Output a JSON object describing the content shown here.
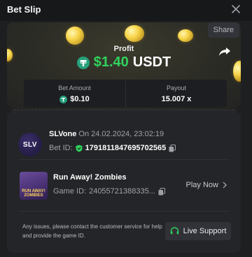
{
  "modal": {
    "title": "Bet Slip"
  },
  "hero": {
    "share_label": "Share",
    "profit_label": "Profit",
    "profit_amount": "$1.40",
    "profit_currency": "USDT"
  },
  "stats": {
    "bet_amount_label": "Bet Amount",
    "bet_amount_value": "$0.10",
    "payout_label": "Payout",
    "payout_value": "15.007 x"
  },
  "bet": {
    "avatar_text": "SLV",
    "username": "SLVone",
    "date_prefix": " On ",
    "date": "24.02.2024, 23:02:19",
    "betid_label": "Bet ID:",
    "betid_value": "1791811847695702565"
  },
  "game": {
    "thumb_text": "RUN AWAY! ZOMBIES",
    "name": "Run Away! Zombies",
    "id_label": "Game ID:",
    "id_value": "24055721388335...",
    "play_label": "Play Now"
  },
  "support": {
    "text": "Any issues, please contact the customer service for help and provide the game ID.",
    "button_label": "Live Support"
  },
  "colors": {
    "accent_green": "#2fd25d",
    "tether": "#26a17b",
    "background": "#1e1f21"
  }
}
